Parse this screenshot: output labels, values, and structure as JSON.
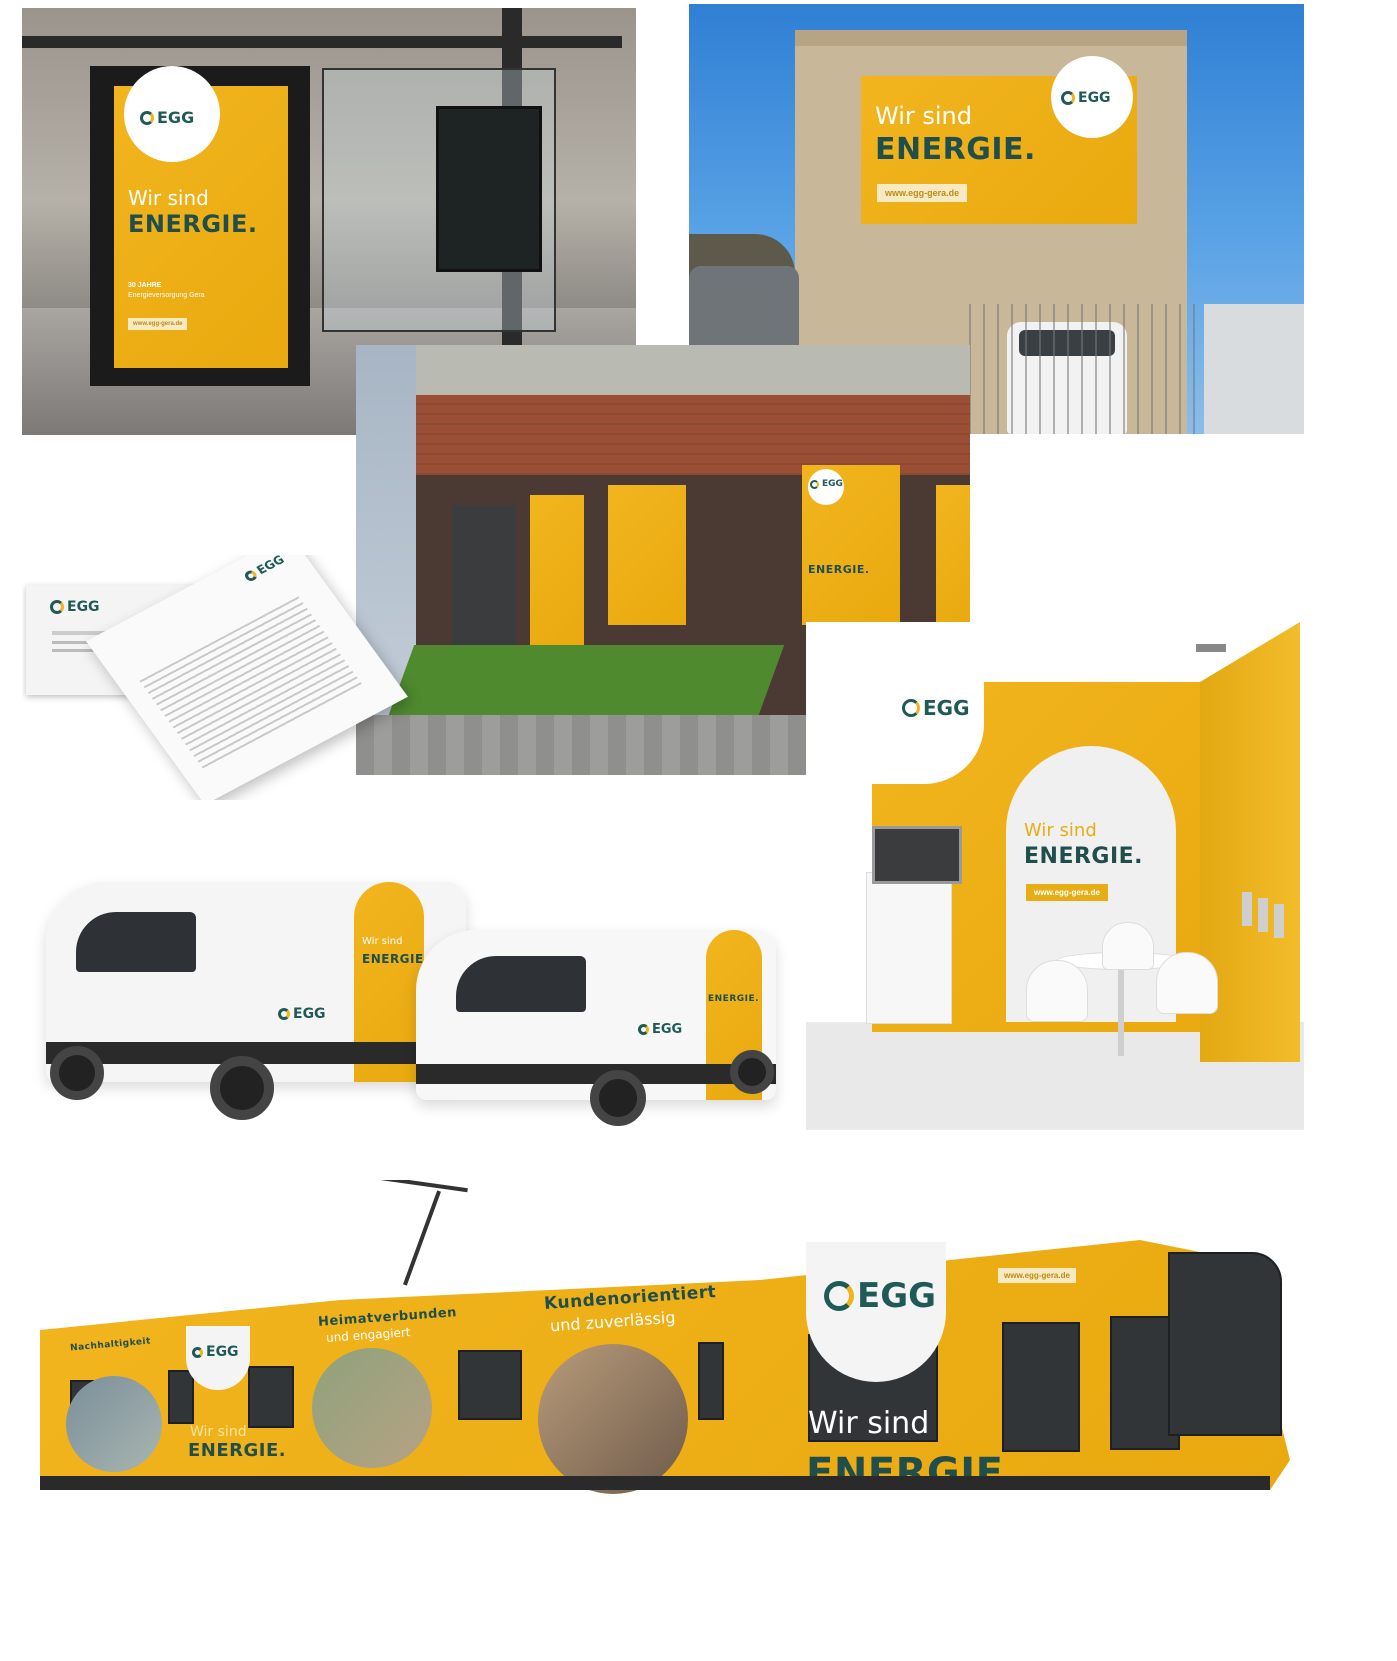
{
  "brand": {
    "logo_text": "EGG",
    "headline_line1": "Wir sind",
    "headline_line2": "ENERGIE.",
    "website": "www.egg-gera.de",
    "colors": {
      "yellow": "#f0b41c",
      "teal": "#1f5a57",
      "white": "#ffffff"
    }
  },
  "bus_shelter": {
    "anniversary": "30 JAHRE",
    "subtitle": "Energieversorgung Gera",
    "website": "www.egg-gera.de"
  },
  "billboard": {
    "website": "www.egg-gera.de"
  },
  "booth": {
    "website": "www.egg-gera.de"
  },
  "tram": {
    "slogan1": "Kundenorientiert",
    "slogan1_sub": "und zuverlässig",
    "slogan2": "Heimatverbunden",
    "slogan2_sub": "und engagiert",
    "slogan3": "Nachhaltigkeit",
    "website": "www.egg-gera.de"
  }
}
